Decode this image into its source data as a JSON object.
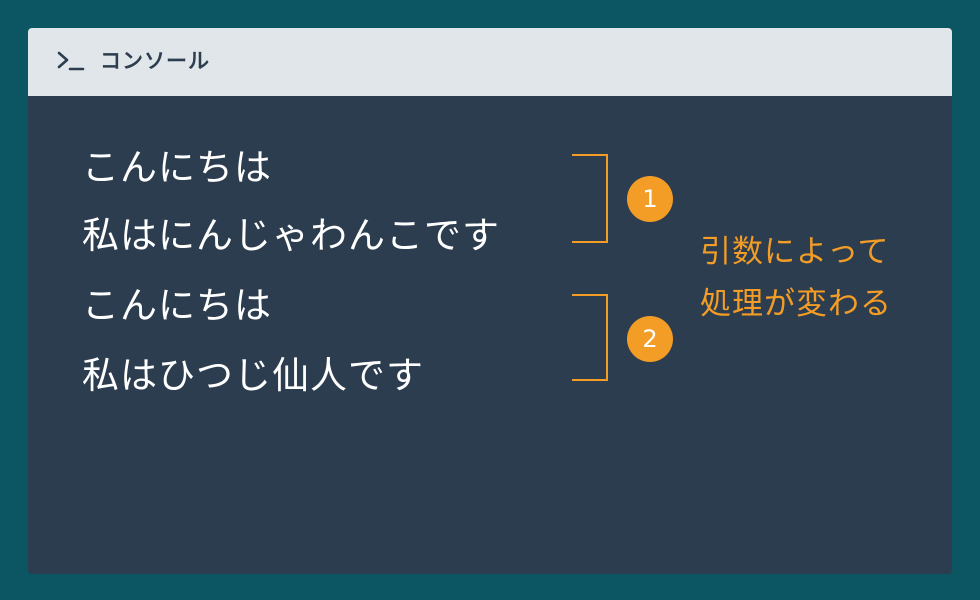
{
  "window": {
    "title": "コンソール",
    "icon": "terminal-prompt-icon"
  },
  "console": {
    "lines": [
      "こんにちは",
      "私はにんじゃわんこです",
      "こんにちは",
      "私はひつじ仙人です"
    ]
  },
  "badges": [
    "1",
    "2"
  ],
  "annotation": {
    "line1": "引数によって",
    "line2": "処理が変わる"
  },
  "colors": {
    "page_background": "#0c5563",
    "console_background": "#2c3d4f",
    "titlebar_background": "#e0e6e9",
    "accent": "#f39c26",
    "text": "#ffffff"
  }
}
